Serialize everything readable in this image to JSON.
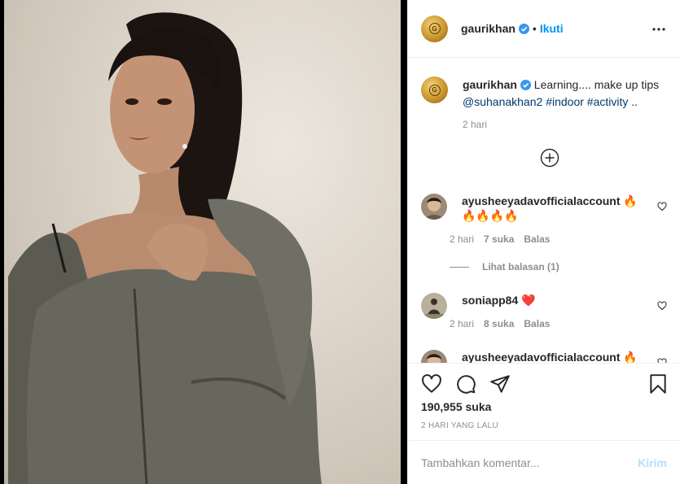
{
  "post": {
    "author": "gaurikhan",
    "follow_label": "Ikuti",
    "dot": "•"
  },
  "caption": {
    "username": "gaurikhan",
    "text": "Learning.... make up tips",
    "mention": "@suhanakhan2",
    "hashtag1": "#indoor",
    "hashtag2": "#activity",
    "trail": "..",
    "time": "2 hari"
  },
  "comments": [
    {
      "username": "ayusheeyadavofficialaccount",
      "text": "🔥 🔥🔥🔥🔥",
      "time": "2 hari",
      "likes": "7 suka",
      "reply": "Balas",
      "view_replies": "Lihat balasan (1)"
    },
    {
      "username": "soniapp84",
      "text": "❤️",
      "time": "2 hari",
      "likes": "8 suka",
      "reply": "Balas"
    },
    {
      "username": "ayusheeyadavofficialaccount",
      "text": "🔥"
    }
  ],
  "stats": {
    "likes": "190,955 suka",
    "posted": "2 HARI YANG LALU"
  },
  "composer": {
    "placeholder": "Tambahkan komentar...",
    "post_label": "Kirim"
  },
  "colors": {
    "accent": "#0095f6",
    "muted": "#8e8e8e",
    "border": "#efefef",
    "post_disabled": "#b2dffc"
  }
}
